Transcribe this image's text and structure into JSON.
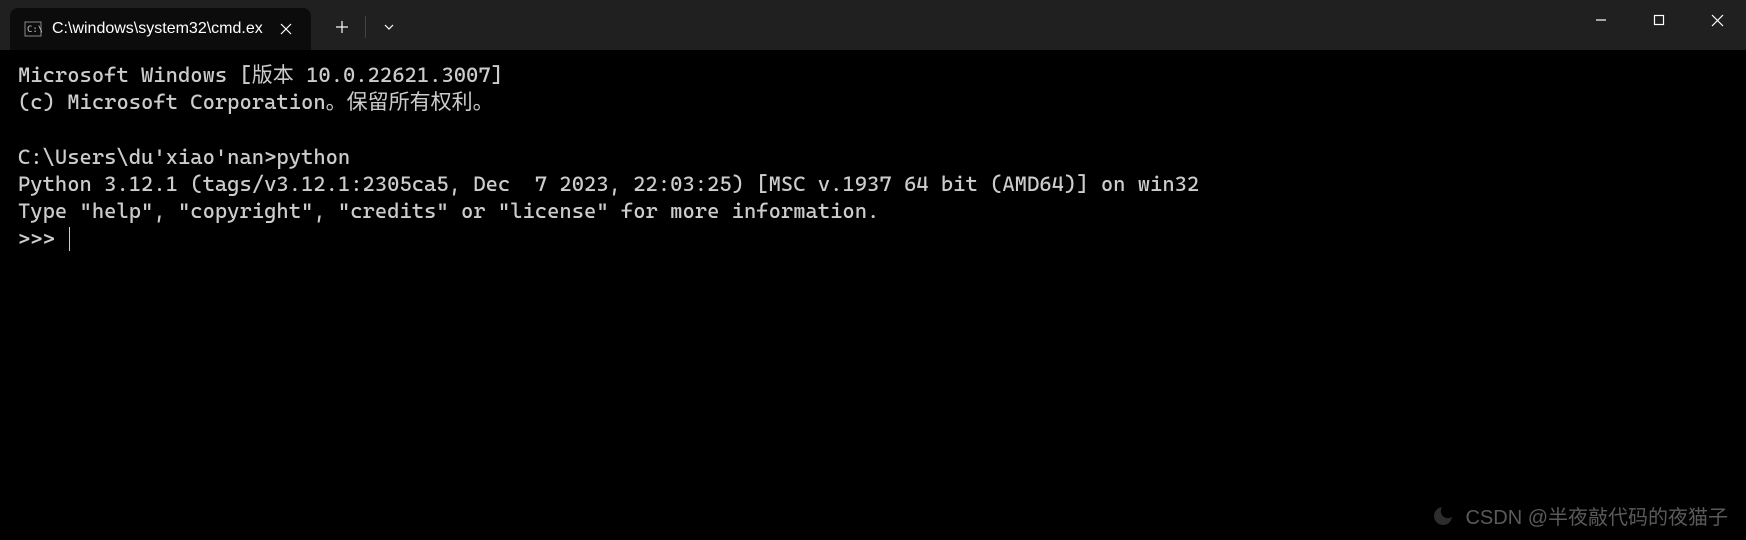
{
  "tab": {
    "title": "C:\\windows\\system32\\cmd.ex"
  },
  "terminal": {
    "line1": "Microsoft Windows [版本 10.0.22621.3007]",
    "line2": "(c) Microsoft Corporation。保留所有权利。",
    "line3": "",
    "line4": "C:\\Users\\du'xiao'nan>python",
    "line5": "Python 3.12.1 (tags/v3.12.1:2305ca5, Dec  7 2023, 22:03:25) [MSC v.1937 64 bit (AMD64)] on win32",
    "line6": "Type \"help\", \"copyright\", \"credits\" or \"license\" for more information.",
    "prompt": ">>> "
  },
  "watermark": {
    "text": "CSDN @半夜敲代码的夜猫子"
  }
}
